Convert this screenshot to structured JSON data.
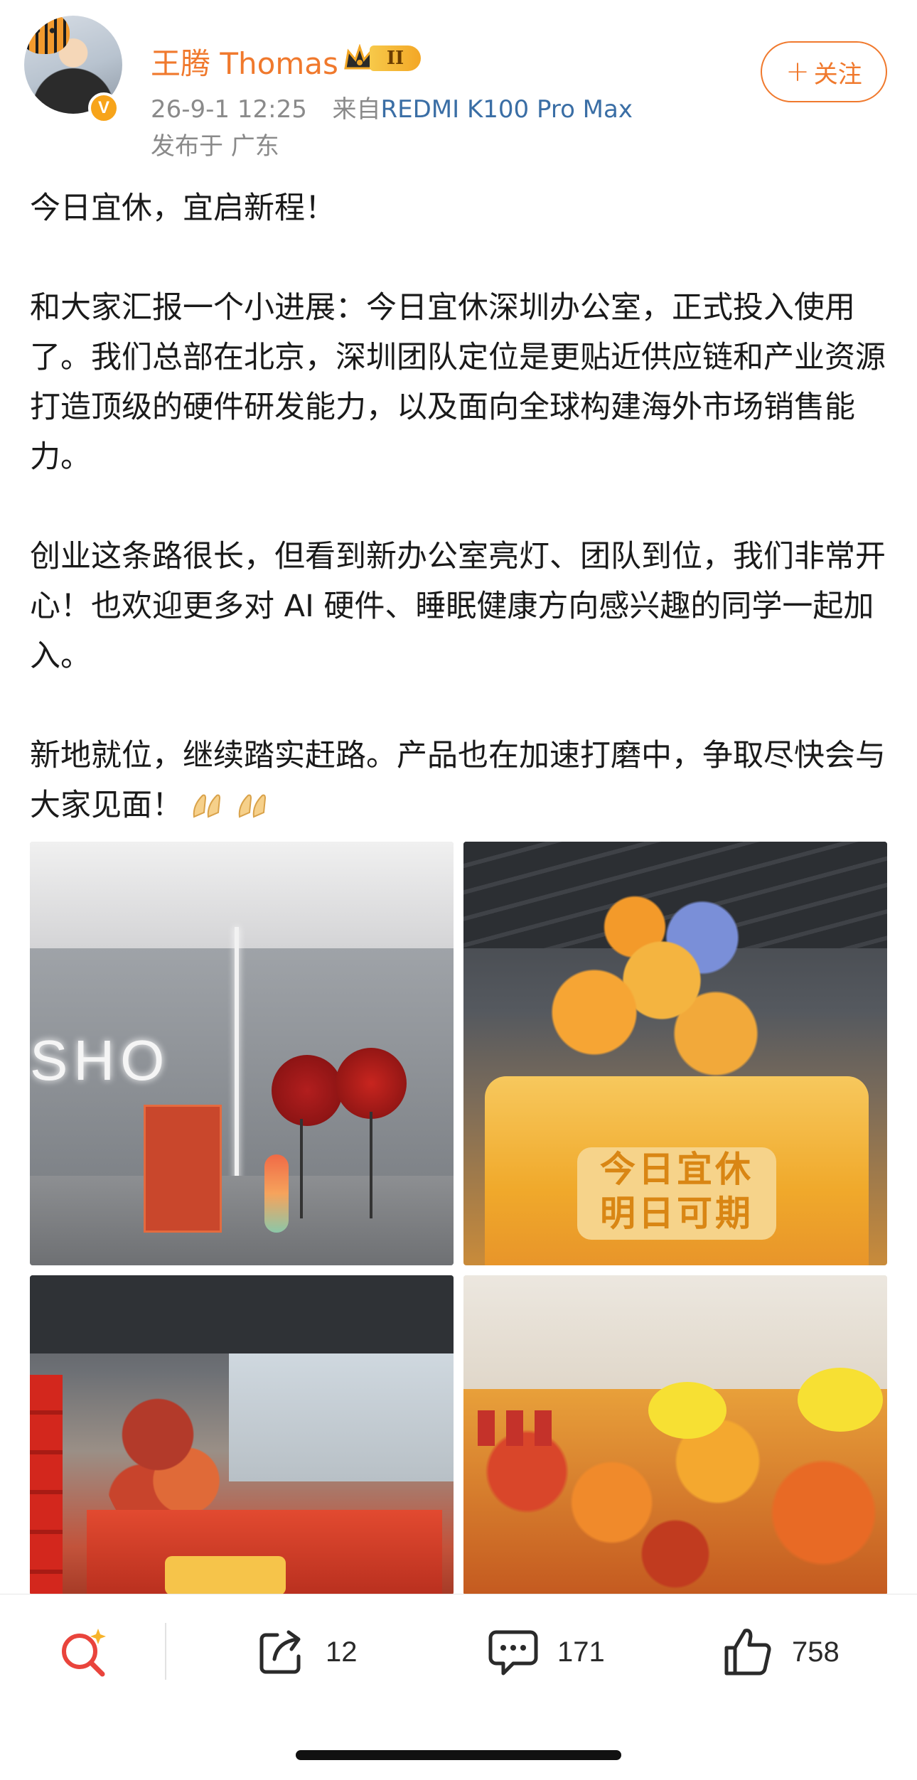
{
  "header": {
    "username": "王腾 Thomas",
    "vip_level": "II",
    "verified_mark": "V",
    "timestamp": "26-9-1 12:25",
    "source_prefix": "来自",
    "device": "REDMI K100 Pro Max",
    "location": "发布于 广东",
    "follow_label": "关注",
    "follow_icon": "plus-icon"
  },
  "post": {
    "paragraphs": [
      "今日宜休，宜启新程！",
      "和大家汇报一个小进展：今日宜休深圳办公室，正式投入使用了。我们总部在北京，深圳团队定位是更贴近供应链和产业资源打造顶级的硬件研发能力，以及面向全球构建海外市场销售能力。",
      "创业这条路很长，但看到新办公室亮灯、团队到位，我们非常开心！也欢迎更多对 AI 硬件、睡眠健康方向感兴趣的同学一起加入。",
      "新地就位，继续踏实赶路。产品也在加速打磨中，争取尽快会与大家见面！"
    ],
    "trailing_emoji": "folded-hands-icon"
  },
  "images": {
    "tile1_logo": "SHO",
    "tile2_plaque": "今日宜休\n明日可期"
  },
  "actions": {
    "share_count": "12",
    "comment_count": "171",
    "like_count": "758"
  },
  "colors": {
    "accent": "#f0792d",
    "link": "#3a6ea5",
    "meta": "#8a8a8a"
  }
}
